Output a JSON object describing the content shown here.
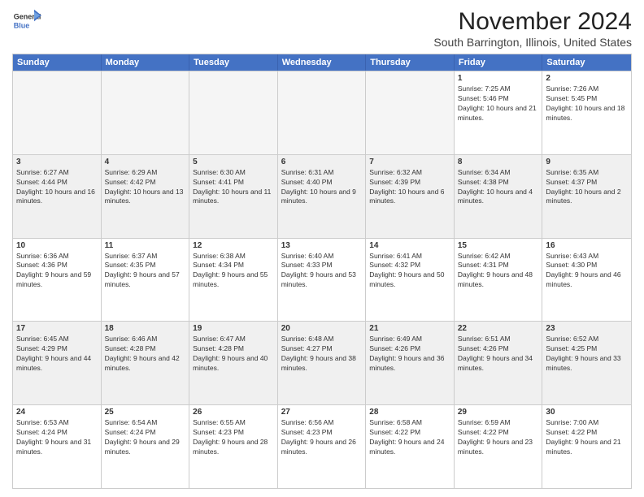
{
  "logo": {
    "line1": "General",
    "line2": "Blue"
  },
  "title": "November 2024",
  "subtitle": "South Barrington, Illinois, United States",
  "header_days": [
    "Sunday",
    "Monday",
    "Tuesday",
    "Wednesday",
    "Thursday",
    "Friday",
    "Saturday"
  ],
  "rows": [
    [
      {
        "day": "",
        "detail": "",
        "empty": true
      },
      {
        "day": "",
        "detail": "",
        "empty": true
      },
      {
        "day": "",
        "detail": "",
        "empty": true
      },
      {
        "day": "",
        "detail": "",
        "empty": true
      },
      {
        "day": "",
        "detail": "",
        "empty": true
      },
      {
        "day": "1",
        "detail": "Sunrise: 7:25 AM\nSunset: 5:46 PM\nDaylight: 10 hours and 21 minutes.",
        "empty": false
      },
      {
        "day": "2",
        "detail": "Sunrise: 7:26 AM\nSunset: 5:45 PM\nDaylight: 10 hours and 18 minutes.",
        "empty": false
      }
    ],
    [
      {
        "day": "3",
        "detail": "Sunrise: 6:27 AM\nSunset: 4:44 PM\nDaylight: 10 hours and 16 minutes.",
        "empty": false
      },
      {
        "day": "4",
        "detail": "Sunrise: 6:29 AM\nSunset: 4:42 PM\nDaylight: 10 hours and 13 minutes.",
        "empty": false
      },
      {
        "day": "5",
        "detail": "Sunrise: 6:30 AM\nSunset: 4:41 PM\nDaylight: 10 hours and 11 minutes.",
        "empty": false
      },
      {
        "day": "6",
        "detail": "Sunrise: 6:31 AM\nSunset: 4:40 PM\nDaylight: 10 hours and 9 minutes.",
        "empty": false
      },
      {
        "day": "7",
        "detail": "Sunrise: 6:32 AM\nSunset: 4:39 PM\nDaylight: 10 hours and 6 minutes.",
        "empty": false
      },
      {
        "day": "8",
        "detail": "Sunrise: 6:34 AM\nSunset: 4:38 PM\nDaylight: 10 hours and 4 minutes.",
        "empty": false
      },
      {
        "day": "9",
        "detail": "Sunrise: 6:35 AM\nSunset: 4:37 PM\nDaylight: 10 hours and 2 minutes.",
        "empty": false
      }
    ],
    [
      {
        "day": "10",
        "detail": "Sunrise: 6:36 AM\nSunset: 4:36 PM\nDaylight: 9 hours and 59 minutes.",
        "empty": false
      },
      {
        "day": "11",
        "detail": "Sunrise: 6:37 AM\nSunset: 4:35 PM\nDaylight: 9 hours and 57 minutes.",
        "empty": false
      },
      {
        "day": "12",
        "detail": "Sunrise: 6:38 AM\nSunset: 4:34 PM\nDaylight: 9 hours and 55 minutes.",
        "empty": false
      },
      {
        "day": "13",
        "detail": "Sunrise: 6:40 AM\nSunset: 4:33 PM\nDaylight: 9 hours and 53 minutes.",
        "empty": false
      },
      {
        "day": "14",
        "detail": "Sunrise: 6:41 AM\nSunset: 4:32 PM\nDaylight: 9 hours and 50 minutes.",
        "empty": false
      },
      {
        "day": "15",
        "detail": "Sunrise: 6:42 AM\nSunset: 4:31 PM\nDaylight: 9 hours and 48 minutes.",
        "empty": false
      },
      {
        "day": "16",
        "detail": "Sunrise: 6:43 AM\nSunset: 4:30 PM\nDaylight: 9 hours and 46 minutes.",
        "empty": false
      }
    ],
    [
      {
        "day": "17",
        "detail": "Sunrise: 6:45 AM\nSunset: 4:29 PM\nDaylight: 9 hours and 44 minutes.",
        "empty": false
      },
      {
        "day": "18",
        "detail": "Sunrise: 6:46 AM\nSunset: 4:28 PM\nDaylight: 9 hours and 42 minutes.",
        "empty": false
      },
      {
        "day": "19",
        "detail": "Sunrise: 6:47 AM\nSunset: 4:28 PM\nDaylight: 9 hours and 40 minutes.",
        "empty": false
      },
      {
        "day": "20",
        "detail": "Sunrise: 6:48 AM\nSunset: 4:27 PM\nDaylight: 9 hours and 38 minutes.",
        "empty": false
      },
      {
        "day": "21",
        "detail": "Sunrise: 6:49 AM\nSunset: 4:26 PM\nDaylight: 9 hours and 36 minutes.",
        "empty": false
      },
      {
        "day": "22",
        "detail": "Sunrise: 6:51 AM\nSunset: 4:26 PM\nDaylight: 9 hours and 34 minutes.",
        "empty": false
      },
      {
        "day": "23",
        "detail": "Sunrise: 6:52 AM\nSunset: 4:25 PM\nDaylight: 9 hours and 33 minutes.",
        "empty": false
      }
    ],
    [
      {
        "day": "24",
        "detail": "Sunrise: 6:53 AM\nSunset: 4:24 PM\nDaylight: 9 hours and 31 minutes.",
        "empty": false
      },
      {
        "day": "25",
        "detail": "Sunrise: 6:54 AM\nSunset: 4:24 PM\nDaylight: 9 hours and 29 minutes.",
        "empty": false
      },
      {
        "day": "26",
        "detail": "Sunrise: 6:55 AM\nSunset: 4:23 PM\nDaylight: 9 hours and 28 minutes.",
        "empty": false
      },
      {
        "day": "27",
        "detail": "Sunrise: 6:56 AM\nSunset: 4:23 PM\nDaylight: 9 hours and 26 minutes.",
        "empty": false
      },
      {
        "day": "28",
        "detail": "Sunrise: 6:58 AM\nSunset: 4:22 PM\nDaylight: 9 hours and 24 minutes.",
        "empty": false
      },
      {
        "day": "29",
        "detail": "Sunrise: 6:59 AM\nSunset: 4:22 PM\nDaylight: 9 hours and 23 minutes.",
        "empty": false
      },
      {
        "day": "30",
        "detail": "Sunrise: 7:00 AM\nSunset: 4:22 PM\nDaylight: 9 hours and 21 minutes.",
        "empty": false
      }
    ]
  ]
}
